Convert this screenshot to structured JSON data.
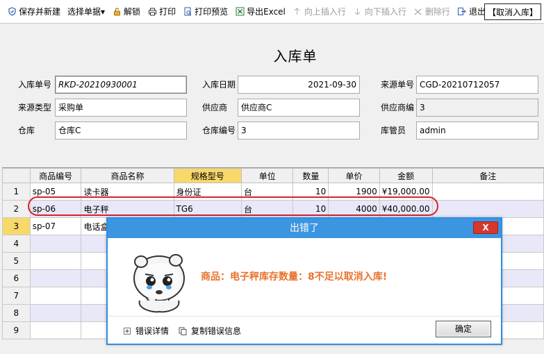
{
  "toolbar": {
    "items": [
      {
        "label": "保存并新建",
        "icon": "shield-icon"
      },
      {
        "label": "选择单据▾",
        "icon": ""
      },
      {
        "label": "解锁",
        "icon": "unlock-icon"
      },
      {
        "label": "打印",
        "icon": "printer-icon"
      },
      {
        "label": "打印预览",
        "icon": "print-preview-icon"
      },
      {
        "label": "导出Excel",
        "icon": "excel-icon"
      },
      {
        "label": "向上插入行",
        "icon": "insert-row-above-icon"
      },
      {
        "label": "向下插入行",
        "icon": "insert-row-below-icon"
      },
      {
        "label": "删除行",
        "icon": "delete-row-icon"
      },
      {
        "label": "退出",
        "icon": "exit-icon"
      }
    ],
    "cancel_label": "【取消入库】"
  },
  "form": {
    "title": "入库单",
    "fields": {
      "doc_no": {
        "label": "入库单号",
        "value": "RKD-20210930001"
      },
      "date": {
        "label": "入库日期",
        "value": "2021-09-30"
      },
      "source_no": {
        "label": "来源单号",
        "value": "CGD-20210712057"
      },
      "source_type": {
        "label": "来源类型",
        "value": "采购单"
      },
      "supplier": {
        "label": "供应商",
        "value": "供应商C"
      },
      "supplier_code": {
        "label": "供应商编",
        "value": "3"
      },
      "warehouse": {
        "label": "仓库",
        "value": "仓库C"
      },
      "warehouse_code": {
        "label": "仓库编号",
        "value": "3"
      },
      "keeper": {
        "label": "库管员",
        "value": "admin"
      }
    }
  },
  "grid": {
    "columns": [
      "商品编号",
      "商品名称",
      "规格型号",
      "单位",
      "数量",
      "单价",
      "金额",
      "备注"
    ],
    "rows": [
      [
        "sp-05",
        "读卡器",
        "身份证",
        "台",
        "10",
        "1900",
        "¥19,000.00",
        ""
      ],
      [
        "sp-06",
        "电子秤",
        "TG6",
        "台",
        "10",
        "4000",
        "¥40,000.00",
        ""
      ],
      [
        "sp-07",
        "电话盒",
        "",
        "",
        "",
        "",
        "",
        ""
      ],
      [
        "",
        "",
        "",
        "",
        "",
        "",
        "",
        ""
      ],
      [
        "",
        "",
        "",
        "",
        "",
        "",
        "",
        ""
      ],
      [
        "",
        "",
        "",
        "",
        "",
        "",
        "",
        ""
      ],
      [
        "",
        "",
        "",
        "",
        "",
        "",
        "",
        ""
      ],
      [
        "",
        "",
        "",
        "",
        "",
        "",
        "",
        ""
      ],
      [
        "",
        "",
        "",
        "",
        "",
        "",
        "",
        ""
      ]
    ],
    "row_numbers": [
      "1",
      "2",
      "3",
      "4",
      "5",
      "6",
      "7",
      "8",
      "9"
    ]
  },
  "dialog": {
    "title": "出错了",
    "close_label": "X",
    "message": "商品：电子秤库存数量：8不足以取消入库!",
    "details_label": "错误详情",
    "copy_label": "复制错误信息",
    "ok_label": "确定"
  },
  "colors": {
    "accent": "#3b95e0",
    "highlight": "#f7d86a",
    "error_text": "#e8722c",
    "annotation": "#d9202a"
  }
}
